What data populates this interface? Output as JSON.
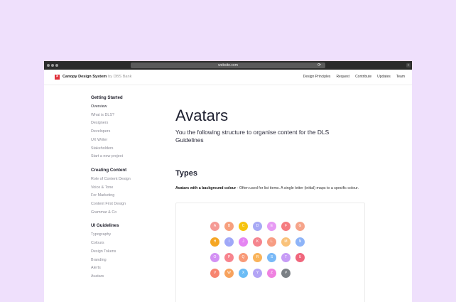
{
  "browser": {
    "url": "website.com",
    "reload_glyph": "⟳",
    "new_tab_glyph": "+"
  },
  "header": {
    "logo_glyph": "×",
    "brand_name": "Canopy Design System",
    "brand_by": "by DBS Bank",
    "nav": [
      "Design Principles",
      "Request",
      "Contribute",
      "Updates",
      "Team"
    ]
  },
  "sidebar": {
    "sections": [
      {
        "title": "Getting Started",
        "items": [
          "Overview",
          "What is DLS?",
          "Designers",
          "Developers",
          "UX Writer",
          "Stakeholders",
          "Start a new project"
        ]
      },
      {
        "title": "Creating Content",
        "items": [
          "Role of Content Design",
          "Voice & Tone",
          "For Marketing",
          "Content First Design",
          "Grammar & Co"
        ]
      },
      {
        "title": "UI Guidelines",
        "items": [
          "Typography",
          "Colours",
          "Design Tokens",
          "Branding",
          "Alerts",
          "Avatars"
        ]
      }
    ]
  },
  "main": {
    "title": "Avatars",
    "subtitle": "You the following structure to organise content for the DLS Guidelines",
    "section_title": "Types",
    "description_bold": "Avatars with a background colour",
    "description_rest": " - Often used for list items. A single letter (initial) maps to a specific colour."
  },
  "avatars": [
    [
      {
        "l": "A",
        "c": "#f59a95"
      },
      {
        "l": "B",
        "c": "#f7a07e"
      },
      {
        "l": "C",
        "c": "#f6c40f"
      },
      {
        "l": "D",
        "c": "#a7a9f5"
      },
      {
        "l": "E",
        "c": "#e79bf4"
      },
      {
        "l": "F",
        "c": "#f57c80"
      },
      {
        "l": "G",
        "c": "#f6a48a"
      }
    ],
    [
      {
        "l": "H",
        "c": "#f5a623"
      },
      {
        "l": "I",
        "c": "#a0a8f8"
      },
      {
        "l": "J",
        "c": "#e585f2"
      },
      {
        "l": "K",
        "c": "#f5858e"
      },
      {
        "l": "L",
        "c": "#f79d83"
      },
      {
        "l": "M",
        "c": "#f9c27a"
      },
      {
        "l": "N",
        "c": "#8eb4f8"
      }
    ],
    [
      {
        "l": "O",
        "c": "#d391f4"
      },
      {
        "l": "P",
        "c": "#f7848e"
      },
      {
        "l": "Q",
        "c": "#f89a78"
      },
      {
        "l": "R",
        "c": "#f9b35a"
      },
      {
        "l": "S",
        "c": "#79b9f7"
      },
      {
        "l": "T",
        "c": "#c79cf6"
      },
      {
        "l": "U",
        "c": "#f0667c"
      }
    ],
    [
      {
        "l": "V",
        "c": "#f7846f"
      },
      {
        "l": "W",
        "c": "#f7a25d"
      },
      {
        "l": "X",
        "c": "#6bbcf5"
      },
      {
        "l": "Y",
        "c": "#b3a4f5"
      },
      {
        "l": "Z",
        "c": "#ef82e0"
      },
      {
        "l": "#",
        "c": "#7b8085"
      }
    ]
  ]
}
